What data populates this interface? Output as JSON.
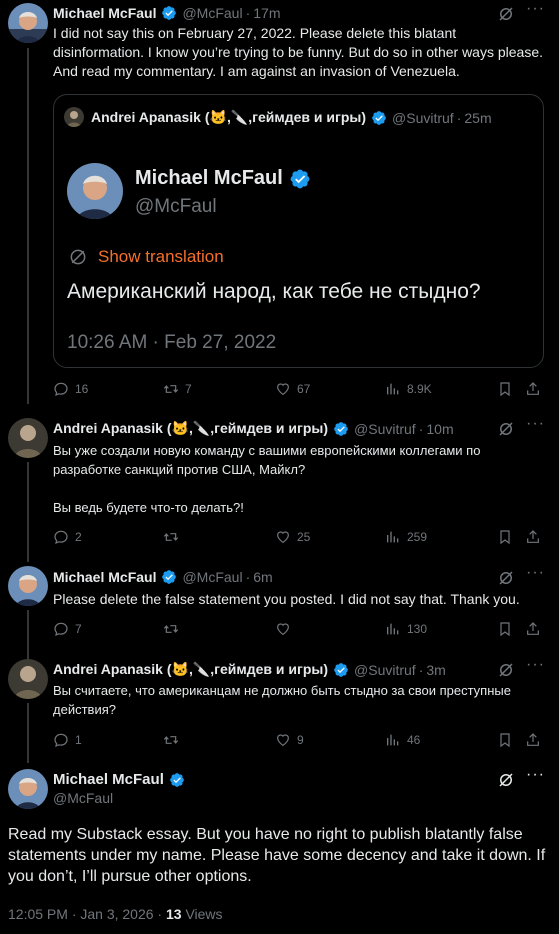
{
  "tweets": [
    {
      "name": "Michael McFaul",
      "handle": "@McFaul",
      "time": "17m",
      "text": "I did not say this on February 27, 2022. Please delete this blatant disinformation. I know you’re trying to be funny. But do so in other ways please. And read my commentary. I am against an invasion of Venezuela.",
      "quote": {
        "name": "Andrei Apanasik (🐱,🔪,геймдев и игры)",
        "handle": "@Suvitruf",
        "time": "25m",
        "inner_name": "Michael McFaul",
        "inner_handle": "@McFaul",
        "show_translation": "Show translation",
        "text": "Американский народ, как тебе не стыдно?",
        "timestamp": "10:26 AM · Feb 27, 2022"
      },
      "stats": {
        "replies": "16",
        "retweets": "7",
        "likes": "67",
        "views": "8.9K"
      }
    },
    {
      "name": "Andrei Apanasik (🐱,🔪,геймдев и игры)",
      "handle": "@Suvitruf",
      "time": "10m",
      "text_lines": [
        "Вы уже создали новую команду с вашими европейскими коллегами по разработке санкций против США, Майкл?",
        "Вы ведь будете что-то делать?!"
      ],
      "stats": {
        "replies": "2",
        "retweets": "",
        "likes": "25",
        "views": "259"
      }
    },
    {
      "name": "Michael McFaul",
      "handle": "@McFaul",
      "time": "6m",
      "text": "Please delete the false statement you posted. I did not say that. Thank you.",
      "stats": {
        "replies": "7",
        "retweets": "",
        "likes": "",
        "views": "130"
      }
    },
    {
      "name": "Andrei Apanasik (🐱,🔪,геймдев и игры)",
      "handle": "@Suvitruf",
      "time": "3m",
      "text": "Вы считаете, что американцам не должно быть стыдно за свои преступные действия?",
      "stats": {
        "replies": "1",
        "retweets": "",
        "likes": "9",
        "views": "46"
      }
    }
  ],
  "main": {
    "name": "Michael McFaul",
    "handle": "@McFaul",
    "text": "Read my Substack essay. But you have no right to publish blatantly false statements under my name.  Please have some decency and take it down. If you don’t, I’ll pursue other options.",
    "timestamp": "12:05 PM · Jan 3, 2026 · ",
    "views_count": "13",
    "views_label": " Views"
  },
  "sep": "·",
  "colors": {
    "verified": "#1d9bf0",
    "translation": "#f4702a",
    "text": "#e7e9ea",
    "muted": "#71767b"
  }
}
